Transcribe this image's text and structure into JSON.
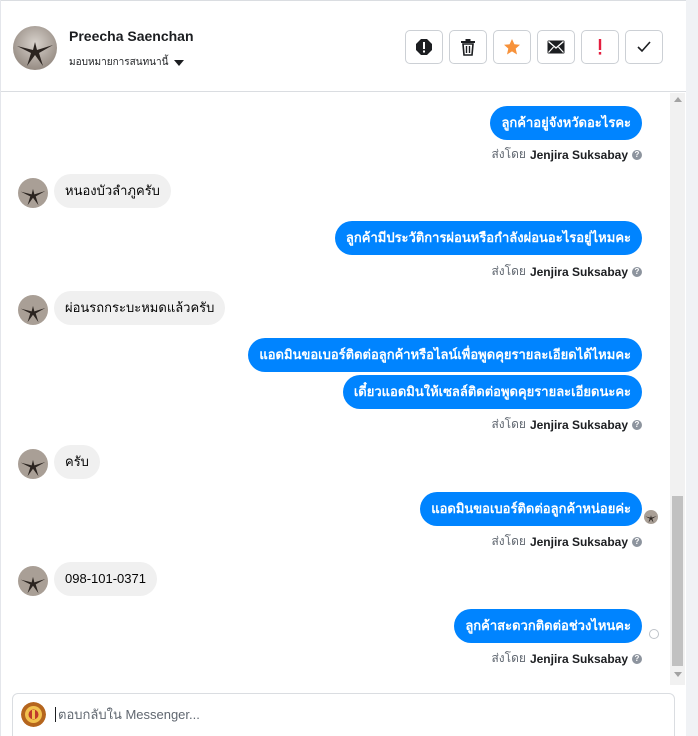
{
  "header": {
    "contact_name": "Preecha Saenchan",
    "assign_label": "มอบหมายการสนทนานี้",
    "actions": [
      {
        "name": "report-icon",
        "label": "!"
      },
      {
        "name": "trash-icon",
        "label": ""
      },
      {
        "name": "star-icon",
        "label": ""
      },
      {
        "name": "mail-icon",
        "label": ""
      },
      {
        "name": "exclamation-icon",
        "label": "!"
      },
      {
        "name": "check-icon",
        "label": ""
      }
    ]
  },
  "messages": [
    {
      "dir": "out",
      "text": "ลูกค้าอยู่จังหวัดอะไรคะ"
    },
    {
      "dir": "sent_by",
      "prefix": "ส่งโดย",
      "name": "Jenjira Suksabay"
    },
    {
      "dir": "in",
      "text": "หนองบัวลำภูครับ"
    },
    {
      "dir": "out",
      "text": "ลูกค้ามีประวัติการผ่อนหรือกำลังผ่อนอะไรอยู่ไหมคะ"
    },
    {
      "dir": "sent_by",
      "prefix": "ส่งโดย",
      "name": "Jenjira Suksabay"
    },
    {
      "dir": "in",
      "text": "ผ่อนรถกระบะหมดแล้วครับ"
    },
    {
      "dir": "out",
      "text": "แอดมินขอเบอร์ติดต่อลูกค้าหรือไลน์เพื่อพูดคุยรายละเอียดได้ไหมคะ"
    },
    {
      "dir": "out",
      "text": "เดี๋ยวแอดมินให้เซลล์ติดต่อพูดคุยรายละเอียดนะคะ"
    },
    {
      "dir": "sent_by",
      "prefix": "ส่งโดย",
      "name": "Jenjira Suksabay"
    },
    {
      "dir": "in",
      "text": "ครับ"
    },
    {
      "dir": "out",
      "text": "แอดมินขอเบอร์ติดต่อลูกค้าหน่อยค่ะ"
    },
    {
      "dir": "sent_by",
      "prefix": "ส่งโดย",
      "name": "Jenjira Suksabay"
    },
    {
      "dir": "in",
      "text": "098-101-0371"
    },
    {
      "dir": "out",
      "text": "ลูกค้าสะดวกติดต่อช่วงไหนคะ"
    },
    {
      "dir": "sent_by",
      "prefix": "ส่งโดย",
      "name": "Jenjira Suksabay"
    }
  ],
  "composer": {
    "placeholder": "ตอบกลับใน Messenger..."
  },
  "colors": {
    "outgoing_bubble": "#0084ff",
    "incoming_bubble": "#f0f0f0",
    "star": "#f7923b",
    "alert": "#e41e3f"
  }
}
